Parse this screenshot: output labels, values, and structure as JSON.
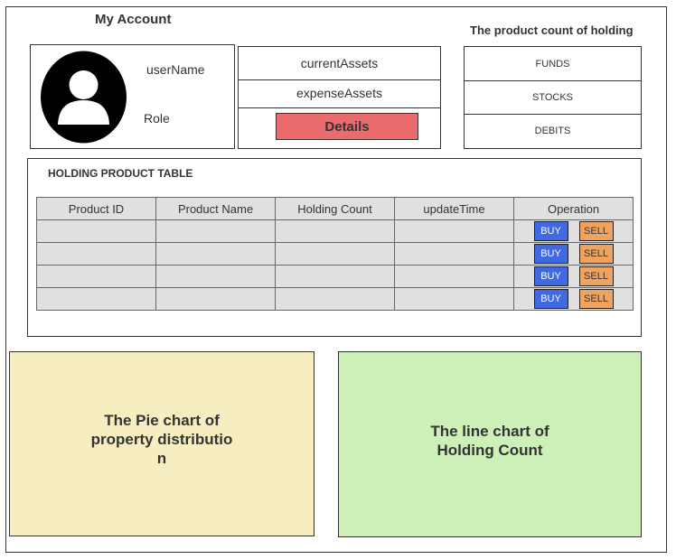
{
  "account": {
    "title": "My Account",
    "user_name": "userName",
    "role": "Role",
    "current_assets": "currentAssets",
    "expense_assets": "expenseAssets",
    "details_label": "Details"
  },
  "product_count": {
    "title": "The product count of holding",
    "items": [
      "FUNDS",
      "STOCKS",
      "DEBITS"
    ]
  },
  "holding_table": {
    "title": "HOLDING PRODUCT TABLE",
    "columns": [
      "Product ID",
      "Product Name",
      "Holding Count",
      "updateTime",
      "Operation"
    ],
    "row_count": 4,
    "buy_label": "BUY",
    "sell_label": "SELL"
  },
  "charts": {
    "pie_label_lines": [
      "The Pie chart of",
      "property distributio",
      "n"
    ],
    "line_label_lines": [
      "The line chart of",
      "Holding Count"
    ]
  },
  "colors": {
    "details_button": "#ea6b6b",
    "buy_button": "#4169e1",
    "sell_button": "#f0a35e",
    "pie_panel": "#f6eec0",
    "line_panel": "#cdefb8",
    "table_cell": "#e0e0e0"
  }
}
